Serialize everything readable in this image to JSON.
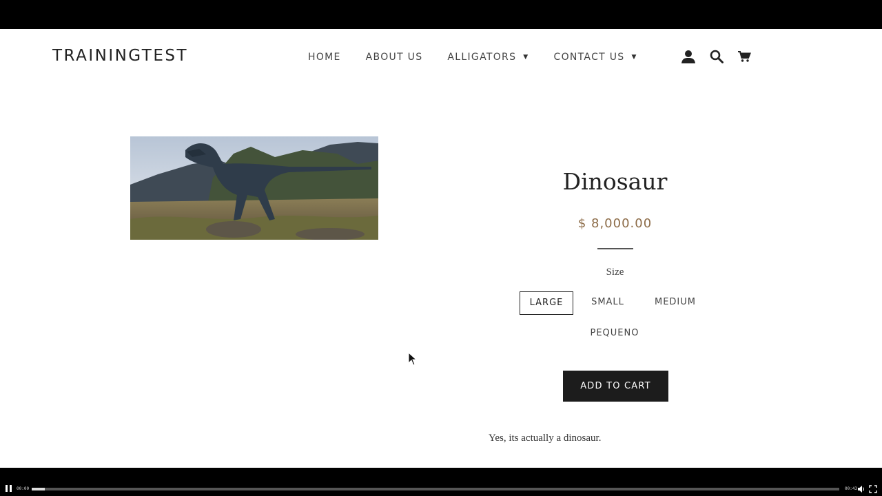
{
  "site": {
    "logo": "TRAININGTEST"
  },
  "nav": {
    "items": [
      {
        "label": "HOME",
        "dropdown": false
      },
      {
        "label": "ABOUT US",
        "dropdown": false
      },
      {
        "label": "ALLIGATORS",
        "dropdown": true
      },
      {
        "label": "CONTACT US",
        "dropdown": true
      }
    ],
    "icons": [
      "account-icon",
      "search-icon",
      "cart-icon"
    ]
  },
  "product": {
    "title": "Dinosaur",
    "price": "$ 8,000.00",
    "size_label": "Size",
    "sizes": [
      "LARGE",
      "SMALL",
      "MEDIUM",
      "PEQUENO"
    ],
    "selected_size": "LARGE",
    "add_to_cart": "ADD TO CART",
    "description": "Yes, its actually a dinosaur."
  },
  "colors": {
    "price": "#8c6b47",
    "button_bg": "#1c1c1c",
    "text": "#222222"
  },
  "video": {
    "current_time": "00:00",
    "duration": "00:43",
    "progress": 0.016
  }
}
